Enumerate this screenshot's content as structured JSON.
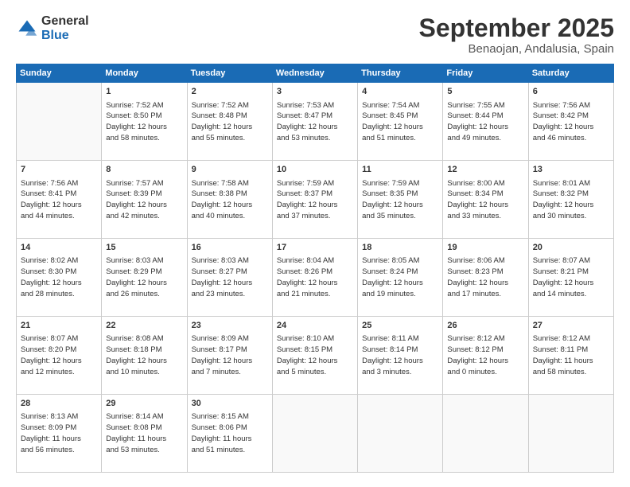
{
  "logo": {
    "general": "General",
    "blue": "Blue"
  },
  "title": "September 2025",
  "subtitle": "Benaojan, Andalusia, Spain",
  "headers": [
    "Sunday",
    "Monday",
    "Tuesday",
    "Wednesday",
    "Thursday",
    "Friday",
    "Saturday"
  ],
  "weeks": [
    [
      {
        "day": "",
        "info": ""
      },
      {
        "day": "1",
        "info": "Sunrise: 7:52 AM\nSunset: 8:50 PM\nDaylight: 12 hours\nand 58 minutes."
      },
      {
        "day": "2",
        "info": "Sunrise: 7:52 AM\nSunset: 8:48 PM\nDaylight: 12 hours\nand 55 minutes."
      },
      {
        "day": "3",
        "info": "Sunrise: 7:53 AM\nSunset: 8:47 PM\nDaylight: 12 hours\nand 53 minutes."
      },
      {
        "day": "4",
        "info": "Sunrise: 7:54 AM\nSunset: 8:45 PM\nDaylight: 12 hours\nand 51 minutes."
      },
      {
        "day": "5",
        "info": "Sunrise: 7:55 AM\nSunset: 8:44 PM\nDaylight: 12 hours\nand 49 minutes."
      },
      {
        "day": "6",
        "info": "Sunrise: 7:56 AM\nSunset: 8:42 PM\nDaylight: 12 hours\nand 46 minutes."
      }
    ],
    [
      {
        "day": "7",
        "info": "Sunrise: 7:56 AM\nSunset: 8:41 PM\nDaylight: 12 hours\nand 44 minutes."
      },
      {
        "day": "8",
        "info": "Sunrise: 7:57 AM\nSunset: 8:39 PM\nDaylight: 12 hours\nand 42 minutes."
      },
      {
        "day": "9",
        "info": "Sunrise: 7:58 AM\nSunset: 8:38 PM\nDaylight: 12 hours\nand 40 minutes."
      },
      {
        "day": "10",
        "info": "Sunrise: 7:59 AM\nSunset: 8:37 PM\nDaylight: 12 hours\nand 37 minutes."
      },
      {
        "day": "11",
        "info": "Sunrise: 7:59 AM\nSunset: 8:35 PM\nDaylight: 12 hours\nand 35 minutes."
      },
      {
        "day": "12",
        "info": "Sunrise: 8:00 AM\nSunset: 8:34 PM\nDaylight: 12 hours\nand 33 minutes."
      },
      {
        "day": "13",
        "info": "Sunrise: 8:01 AM\nSunset: 8:32 PM\nDaylight: 12 hours\nand 30 minutes."
      }
    ],
    [
      {
        "day": "14",
        "info": "Sunrise: 8:02 AM\nSunset: 8:30 PM\nDaylight: 12 hours\nand 28 minutes."
      },
      {
        "day": "15",
        "info": "Sunrise: 8:03 AM\nSunset: 8:29 PM\nDaylight: 12 hours\nand 26 minutes."
      },
      {
        "day": "16",
        "info": "Sunrise: 8:03 AM\nSunset: 8:27 PM\nDaylight: 12 hours\nand 23 minutes."
      },
      {
        "day": "17",
        "info": "Sunrise: 8:04 AM\nSunset: 8:26 PM\nDaylight: 12 hours\nand 21 minutes."
      },
      {
        "day": "18",
        "info": "Sunrise: 8:05 AM\nSunset: 8:24 PM\nDaylight: 12 hours\nand 19 minutes."
      },
      {
        "day": "19",
        "info": "Sunrise: 8:06 AM\nSunset: 8:23 PM\nDaylight: 12 hours\nand 17 minutes."
      },
      {
        "day": "20",
        "info": "Sunrise: 8:07 AM\nSunset: 8:21 PM\nDaylight: 12 hours\nand 14 minutes."
      }
    ],
    [
      {
        "day": "21",
        "info": "Sunrise: 8:07 AM\nSunset: 8:20 PM\nDaylight: 12 hours\nand 12 minutes."
      },
      {
        "day": "22",
        "info": "Sunrise: 8:08 AM\nSunset: 8:18 PM\nDaylight: 12 hours\nand 10 minutes."
      },
      {
        "day": "23",
        "info": "Sunrise: 8:09 AM\nSunset: 8:17 PM\nDaylight: 12 hours\nand 7 minutes."
      },
      {
        "day": "24",
        "info": "Sunrise: 8:10 AM\nSunset: 8:15 PM\nDaylight: 12 hours\nand 5 minutes."
      },
      {
        "day": "25",
        "info": "Sunrise: 8:11 AM\nSunset: 8:14 PM\nDaylight: 12 hours\nand 3 minutes."
      },
      {
        "day": "26",
        "info": "Sunrise: 8:12 AM\nSunset: 8:12 PM\nDaylight: 12 hours\nand 0 minutes."
      },
      {
        "day": "27",
        "info": "Sunrise: 8:12 AM\nSunset: 8:11 PM\nDaylight: 11 hours\nand 58 minutes."
      }
    ],
    [
      {
        "day": "28",
        "info": "Sunrise: 8:13 AM\nSunset: 8:09 PM\nDaylight: 11 hours\nand 56 minutes."
      },
      {
        "day": "29",
        "info": "Sunrise: 8:14 AM\nSunset: 8:08 PM\nDaylight: 11 hours\nand 53 minutes."
      },
      {
        "day": "30",
        "info": "Sunrise: 8:15 AM\nSunset: 8:06 PM\nDaylight: 11 hours\nand 51 minutes."
      },
      {
        "day": "",
        "info": ""
      },
      {
        "day": "",
        "info": ""
      },
      {
        "day": "",
        "info": ""
      },
      {
        "day": "",
        "info": ""
      }
    ]
  ]
}
